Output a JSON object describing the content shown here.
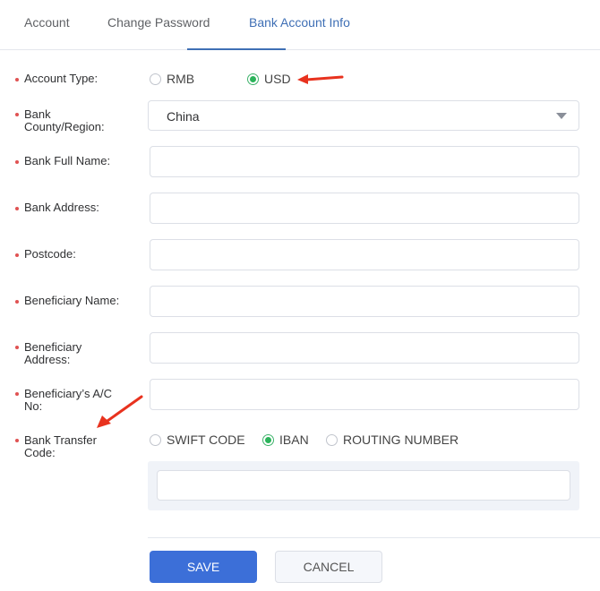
{
  "tabs": [
    {
      "label": "Account",
      "active": false
    },
    {
      "label": "Change Password",
      "active": false
    },
    {
      "label": "Bank Account Info",
      "active": true
    }
  ],
  "form": {
    "account_type": {
      "label": "Account Type:",
      "options": [
        {
          "label": "RMB",
          "checked": false
        },
        {
          "label": "USD",
          "checked": true
        }
      ]
    },
    "bank_country": {
      "label_line1": "Bank",
      "label_line2": "County/Region:",
      "value": "China"
    },
    "bank_full_name": {
      "label": "Bank Full Name:",
      "value": ""
    },
    "bank_address": {
      "label": "Bank Address:",
      "value": ""
    },
    "postcode": {
      "label": "Postcode:",
      "value": ""
    },
    "beneficiary_name": {
      "label": "Beneficiary Name:",
      "value": ""
    },
    "beneficiary_address": {
      "label_line1": "Beneficiary",
      "label_line2": "Address:",
      "value": ""
    },
    "beneficiary_account": {
      "label_line1": "Beneficiary’s A/C",
      "label_line2": "No:",
      "value": ""
    },
    "bank_transfer_code": {
      "label_line1": "Bank Transfer",
      "label_line2": "Code:",
      "options": [
        {
          "label": "SWIFT CODE",
          "checked": false
        },
        {
          "label": "IBAN",
          "checked": true
        },
        {
          "label": "ROUTING NUMBER",
          "checked": false
        }
      ],
      "value": ""
    }
  },
  "buttons": {
    "save": "SAVE",
    "cancel": "CANCEL"
  },
  "colors": {
    "accent": "#3c6fd8",
    "tab_active": "#3f6fb5",
    "radio_checked": "#2bb35a",
    "required_dot": "#e05252",
    "annotation_arrow": "#e8321e"
  }
}
